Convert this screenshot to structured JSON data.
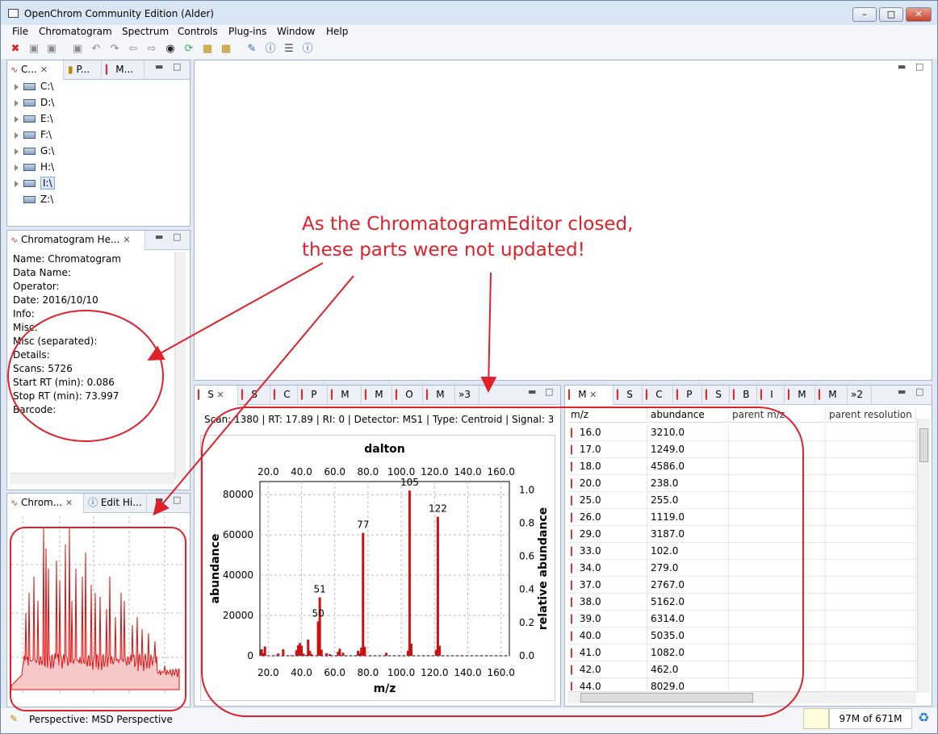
{
  "window": {
    "title": "OpenChrom Community Edition (Alder)"
  },
  "menu": [
    "File",
    "Chromatogram",
    "Spectrum",
    "Controls",
    "Plug-ins",
    "Window",
    "Help"
  ],
  "toolbar": {
    "icons": [
      "delete-icon",
      "save-icon",
      "save-all-icon",
      "save-as-icon",
      "undo-icon",
      "redo-icon",
      "back-icon",
      "forward-icon",
      "camera-icon",
      "refresh-icon",
      "import-icon",
      "export-icon",
      "edit-icon",
      "info-icon",
      "list-icon",
      "help-icon"
    ]
  },
  "navigator": {
    "tabs": [
      "C...",
      "P...",
      "M..."
    ],
    "drives": [
      "C:\\",
      "D:\\",
      "E:\\",
      "F:\\",
      "G:\\",
      "H:\\",
      "I:\\",
      "Z:\\"
    ]
  },
  "header": {
    "tab": "Chromatogram He...",
    "lines": [
      "Name: Chromatogram",
      "Data Name:",
      "Operator:",
      "Date: 2016/10/10",
      "Info:",
      "Misc:",
      "Misc (separated):",
      "Details:",
      "Scans: 5726",
      "Start RT (min): 0.086",
      "Stop RT (min): 73.997",
      "Barcode:"
    ]
  },
  "overview": {
    "tabs": [
      "Chrom...",
      "Edit Hi..."
    ]
  },
  "spectrum": {
    "tabs": [
      "S",
      "S",
      "C",
      "P",
      "M",
      "M",
      "O",
      "M",
      "»3"
    ],
    "info": "Scan: 1380 | RT: 17.89 | RI: 0 | Detector: MS1 | Type: Centroid | Signal: 3724",
    "chart_data": {
      "type": "bar",
      "title": "dalton",
      "xlabel": "m/z",
      "ylabel": "abundance",
      "y2label": "relative abundance",
      "xlim": [
        15,
        165
      ],
      "ylim": [
        0,
        86500
      ],
      "y2lim": [
        0,
        1.05
      ],
      "xticks": [
        "20.0",
        "40.0",
        "60.0",
        "80.0",
        "100.0",
        "120.0",
        "140.0",
        "160.0"
      ],
      "yticks": [
        "0",
        "20000",
        "40000",
        "60000",
        "80000"
      ],
      "y2ticks": [
        "0.0",
        "0.2",
        "0.4",
        "0.6",
        "0.8",
        "1.0"
      ],
      "peaks": [
        {
          "mz": 16,
          "ab": 3210
        },
        {
          "mz": 17,
          "ab": 1249
        },
        {
          "mz": 18,
          "ab": 4586
        },
        {
          "mz": 20,
          "ab": 238
        },
        {
          "mz": 25,
          "ab": 255
        },
        {
          "mz": 26,
          "ab": 1119
        },
        {
          "mz": 29,
          "ab": 3187
        },
        {
          "mz": 33,
          "ab": 102
        },
        {
          "mz": 34,
          "ab": 279
        },
        {
          "mz": 37,
          "ab": 2767
        },
        {
          "mz": 38,
          "ab": 5162
        },
        {
          "mz": 39,
          "ab": 6314
        },
        {
          "mz": 40,
          "ab": 5035
        },
        {
          "mz": 41,
          "ab": 1082
        },
        {
          "mz": 42,
          "ab": 462
        },
        {
          "mz": 44,
          "ab": 8029
        },
        {
          "mz": 45,
          "ab": 2400
        },
        {
          "mz": 46,
          "ab": 900
        },
        {
          "mz": 50,
          "ab": 17000
        },
        {
          "mz": 51,
          "ab": 29000
        },
        {
          "mz": 52,
          "ab": 3000
        },
        {
          "mz": 55,
          "ab": 1200
        },
        {
          "mz": 57,
          "ab": 800
        },
        {
          "mz": 62,
          "ab": 2000
        },
        {
          "mz": 63,
          "ab": 3500
        },
        {
          "mz": 65,
          "ab": 1500
        },
        {
          "mz": 74,
          "ab": 2500
        },
        {
          "mz": 75,
          "ab": 1400
        },
        {
          "mz": 76,
          "ab": 4000
        },
        {
          "mz": 77,
          "ab": 61000
        },
        {
          "mz": 78,
          "ab": 4500
        },
        {
          "mz": 91,
          "ab": 1500
        },
        {
          "mz": 104,
          "ab": 2500
        },
        {
          "mz": 105,
          "ab": 82000
        },
        {
          "mz": 106,
          "ab": 6000
        },
        {
          "mz": 121,
          "ab": 3000
        },
        {
          "mz": 122,
          "ab": 69000
        },
        {
          "mz": 123,
          "ab": 5000
        }
      ],
      "labels": [
        {
          "mz": 50,
          "ab": 17000,
          "text": "50"
        },
        {
          "mz": 51,
          "ab": 29000,
          "text": "51"
        },
        {
          "mz": 77,
          "ab": 61000,
          "text": "77"
        },
        {
          "mz": 105,
          "ab": 82000,
          "text": "105"
        },
        {
          "mz": 122,
          "ab": 69000,
          "text": "122"
        }
      ]
    }
  },
  "table": {
    "tabs": [
      "M",
      "S",
      "C",
      "P",
      "S",
      "B",
      "I",
      "M",
      "M",
      "»2"
    ],
    "columns": [
      "m/z",
      "abundance",
      "parent m/z",
      "parent resolution"
    ],
    "rows": [
      [
        "16.0",
        "3210.0"
      ],
      [
        "17.0",
        "1249.0"
      ],
      [
        "18.0",
        "4586.0"
      ],
      [
        "20.0",
        "238.0"
      ],
      [
        "25.0",
        "255.0"
      ],
      [
        "26.0",
        "1119.0"
      ],
      [
        "29.0",
        "3187.0"
      ],
      [
        "33.0",
        "102.0"
      ],
      [
        "34.0",
        "279.0"
      ],
      [
        "37.0",
        "2767.0"
      ],
      [
        "38.0",
        "5162.0"
      ],
      [
        "39.0",
        "6314.0"
      ],
      [
        "40.0",
        "5035.0"
      ],
      [
        "41.0",
        "1082.0"
      ],
      [
        "42.0",
        "462.0"
      ],
      [
        "44.0",
        "8029.0"
      ]
    ]
  },
  "status": {
    "perspective": "Perspective: MSD Perspective",
    "memory": "97M of 671M"
  },
  "annotation": {
    "line1": "As the ChromatogramEditor closed,",
    "line2": "these parts were not updated!"
  },
  "colors": {
    "annotation": "#e0202a",
    "peak": "#cc1111"
  }
}
